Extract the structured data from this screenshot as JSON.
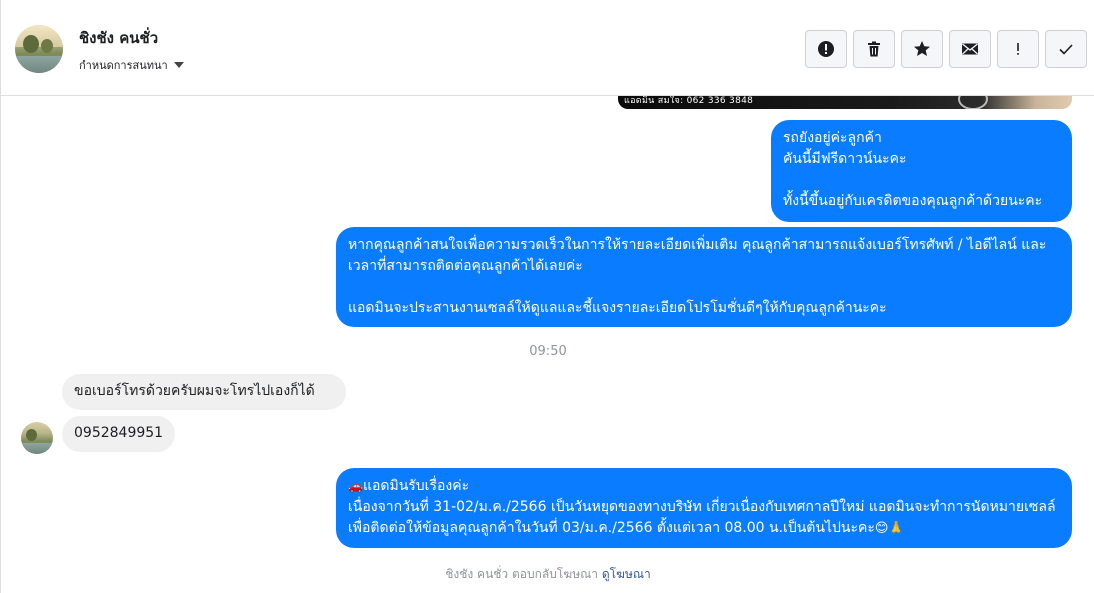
{
  "header": {
    "contact_name": "ชิงชัง คนชั่ว",
    "assign_label": "กำหนดการสนทนา",
    "actions": [
      {
        "name": "alert-button",
        "icon": "exclamation-circle-icon"
      },
      {
        "name": "delete-button",
        "icon": "trash-icon"
      },
      {
        "name": "star-button",
        "icon": "star-icon"
      },
      {
        "name": "mail-button",
        "icon": "envelope-icon"
      },
      {
        "name": "mark-important-button",
        "icon": "exclamation-icon"
      },
      {
        "name": "done-button",
        "icon": "check-icon"
      }
    ]
  },
  "image_strip": {
    "text": "แอดมิน สมใจ: 062 336 3848"
  },
  "messages": {
    "m1": "รถยังอยู่ค่ะลูกค้า\nคันนี้มีฟรีดาวน์นะคะ\n\nทั้งนี้ขึ้นอยู่กับเครดิตของคุณลูกค้าด้วยนะคะ",
    "m2": "หากคุณลูกค้าสนใจเพื่อความรวดเร็วในการให้รายละเอียดเพิ่มเติม คุณลูกค้าสามารถแจ้งเบอร์โทรศัพท์ / ไอดีไลน์ และเวลาที่สามารถติดต่อคุณลูกค้าได้เลยค่ะ\n\nแอดมินจะประสานงานเซลล์ให้ดูแลและชี้แจงรายละเอียดโปรโมชั่นดีๆให้กับคุณลูกค้านะคะ",
    "time": "09:50",
    "m3": "ขอเบอร์โทรด้วยครับผมจะโทรไปเองก็ได้",
    "m4": "0952849951",
    "m5_emoji_car": "🚗",
    "m5_title": "แอดมินรับเรื่องค่ะ",
    "m5_body": "เนื่องจากวันที่ 31-02/ม.ค./2566 เป็นวันหยุดของทางบริษัท เกี่ยวเนื่องกับเทศกาลปีใหม่ แอดมินจะทำการนัดหมายเซลล์เพื่อติดต่อให้ข้อมูลคุณลูกค้าในวันที่ 03/ม.ค./2566 ตั้งแต่เวลา 08.00 น.เป็นต้นไปนะคะ",
    "m5_emoji_end": "😊🙏"
  },
  "footer": {
    "note": "ชิงชัง คนชั่ว ตอบกลับโฆษณา",
    "link": "ดูโฆษณา"
  },
  "colors": {
    "outgoing_bubble": "#0a7cff",
    "incoming_bubble": "#f1f0f0",
    "link": "#365899"
  }
}
